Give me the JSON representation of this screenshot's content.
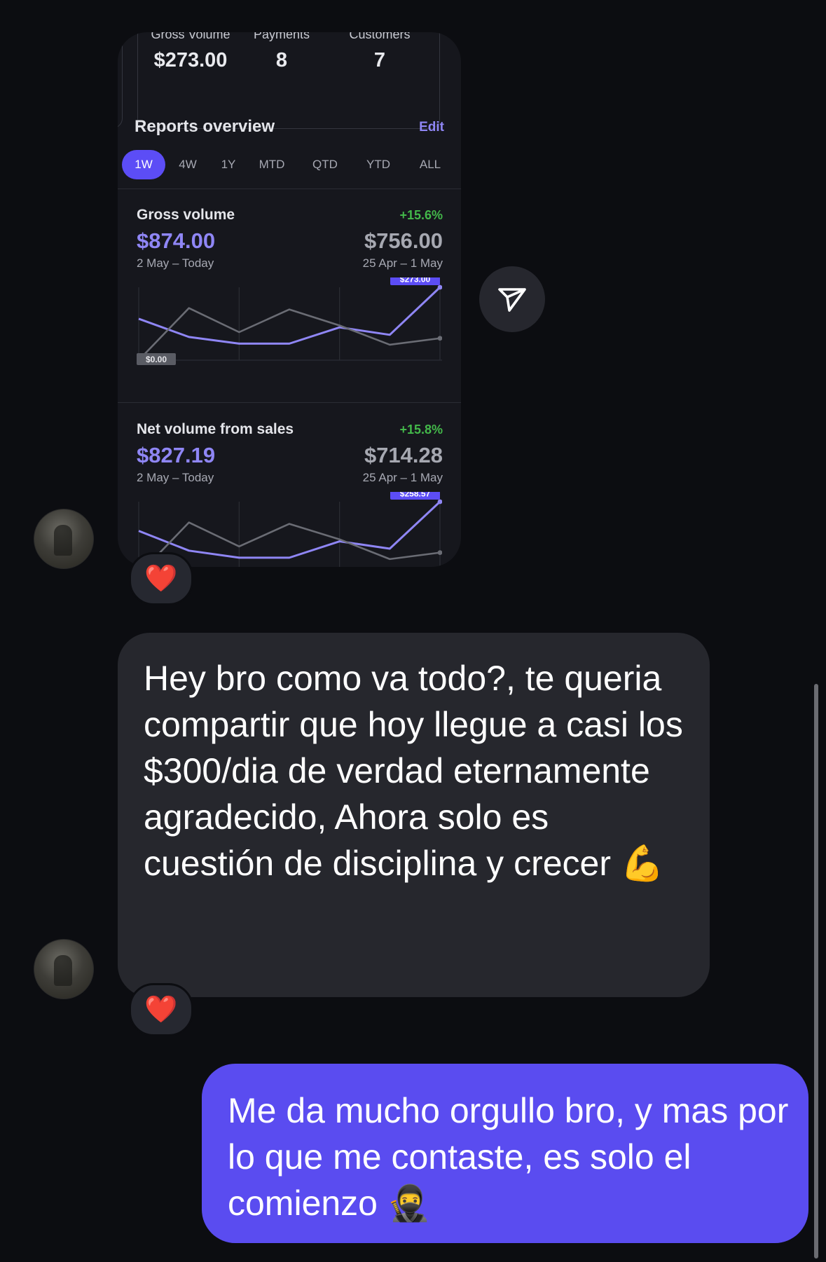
{
  "shared_card": {
    "stats": [
      {
        "label": "Gross Volume",
        "value": "$273.00"
      },
      {
        "label": "Payments",
        "value": "8"
      },
      {
        "label": "Customers",
        "value": "7"
      }
    ],
    "reports_title": "Reports overview",
    "edit_label": "Edit",
    "tabs": [
      "1W",
      "4W",
      "1Y",
      "MTD",
      "QTD",
      "YTD",
      "ALL"
    ],
    "active_tab": "1W",
    "gross": {
      "title": "Gross volume",
      "change": "+15.6%",
      "current": "$874.00",
      "previous": "$756.00",
      "current_range": "2 May – Today",
      "previous_range": "25 Apr – 1 May",
      "max_label": "$273.00",
      "min_label": "$0.00"
    },
    "net": {
      "title": "Net volume from sales",
      "change": "+15.8%",
      "current": "$827.19",
      "previous": "$714.28",
      "current_range": "2 May – Today",
      "previous_range": "25 Apr – 1 May",
      "max_label": "$258.57"
    }
  },
  "messages": {
    "incoming_text": "Hey bro como va todo?, te queria compartir que hoy llegue a casi los $300/dia de verdad eternamente agradecido, Ahora solo es cuestión de disciplina y crecer 💪",
    "outgoing_text": "Me da mucho orgullo bro, y mas por lo que me contaste, es solo el comienzo 🥷",
    "reaction_1": "❤️",
    "reaction_2": "❤️"
  },
  "icons": {
    "send": "paper-plane-icon",
    "avatar": "avatar"
  },
  "colors": {
    "accent": "#5c4df6",
    "current_series": "#8f86f5",
    "previous_series": "#6a6c74",
    "positive": "#43b84a",
    "outgoing_bubble": "#5a4cf0",
    "incoming_bubble": "#26272d"
  },
  "chart_data": [
    {
      "type": "line",
      "title": "Gross volume",
      "x": [
        "1",
        "2",
        "3",
        "4",
        "5",
        "6",
        "7"
      ],
      "series": [
        {
          "values": [
            155,
            87,
            62,
            62,
            123,
            95,
            273
          ]
        },
        {
          "values": [
            0,
            195,
            105,
            190,
            130,
            58,
            82
          ]
        }
      ],
      "ylim": [
        0,
        273
      ],
      "annotations": [
        "$273.00",
        "$0.00"
      ]
    },
    {
      "type": "line",
      "title": "Net volume from sales",
      "x": [
        "1",
        "2",
        "3",
        "4",
        "5",
        "6",
        "7"
      ],
      "series": [
        {
          "values": [
            155,
            85,
            60,
            60,
            118,
            92,
            258.57
          ]
        },
        {
          "values": [
            0,
            185,
            100,
            180,
            125,
            55,
            78
          ]
        }
      ],
      "ylim": [
        0,
        258.57
      ],
      "annotations": [
        "$258.57"
      ]
    }
  ]
}
